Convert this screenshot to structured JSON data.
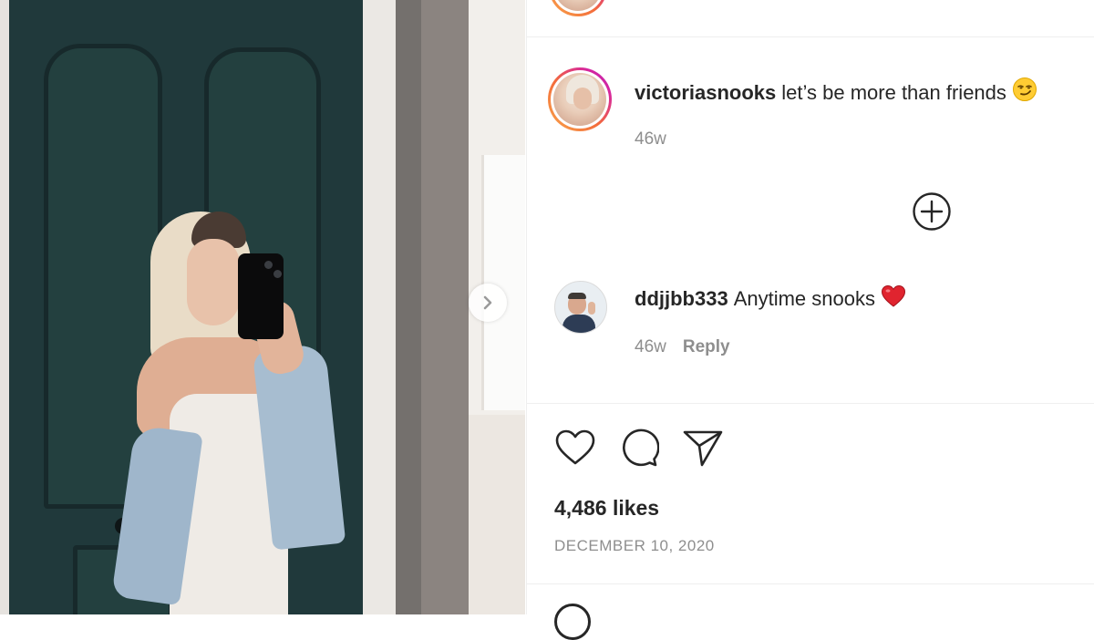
{
  "post": {
    "author": "victoriasnooks",
    "caption": "let’s be more than friends",
    "caption_emoji": "smirking-face-emoji",
    "caption_age": "46w"
  },
  "comments": [
    {
      "username": "ddjjbb333",
      "text": "Anytime snooks",
      "emoji": "red-heart-emoji",
      "age": "46w",
      "reply_label": "Reply"
    }
  ],
  "load_more_icon": "plus-circle-icon",
  "actions": {
    "like_icon": "heart-icon",
    "comment_icon": "comment-icon",
    "share_icon": "send-icon"
  },
  "likes_text": "4,486 likes",
  "date_text": "DECEMBER 10, 2020",
  "carousel": {
    "next_icon": "chevron-right-icon"
  },
  "colors": {
    "text": "#262626",
    "secondary_text": "#8e8e8e",
    "divider": "#efefef",
    "ring_start": "#f9a64b",
    "ring_end": "#b12fbf",
    "heart_emoji": "#e0242f"
  }
}
